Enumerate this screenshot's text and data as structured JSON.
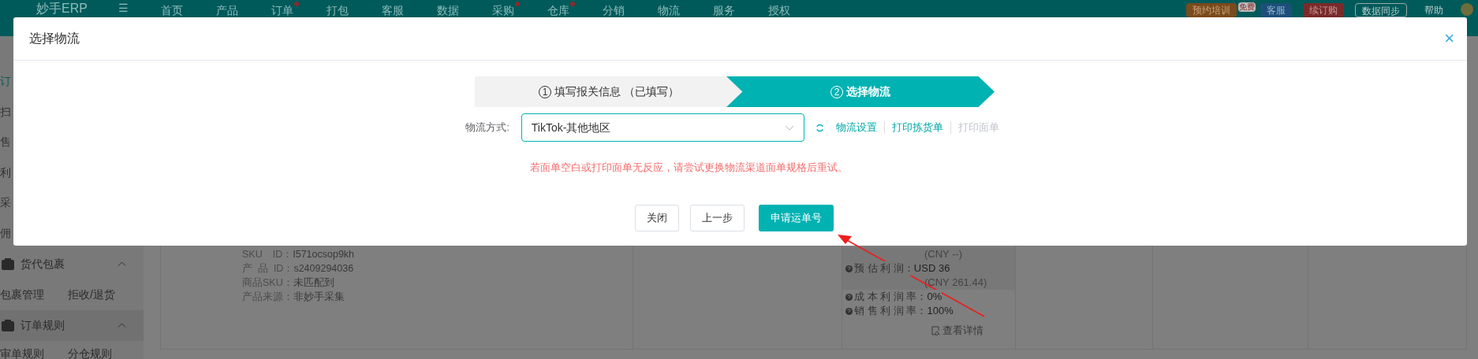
{
  "header": {
    "logo": "妙手ERP",
    "menu_icon": "☰",
    "nav": [
      {
        "label": "首页",
        "dot": false
      },
      {
        "label": "产品",
        "dot": false
      },
      {
        "label": "订单",
        "dot": true
      },
      {
        "label": "打包",
        "dot": false
      },
      {
        "label": "客服",
        "dot": false
      },
      {
        "label": "数据",
        "dot": false
      },
      {
        "label": "采购",
        "dot": true
      },
      {
        "label": "仓库",
        "dot": true
      },
      {
        "label": "分销",
        "dot": false
      },
      {
        "label": "物流",
        "dot": false
      },
      {
        "label": "服务",
        "dot": false
      },
      {
        "label": "授权",
        "dot": false
      }
    ],
    "actions": [
      {
        "label": "预约培训",
        "kind": "orange",
        "badge": "免费"
      },
      {
        "label": "客服",
        "kind": "blue"
      },
      {
        "label": "续订购",
        "kind": "red"
      },
      {
        "label": "数据同步",
        "kind": "outline"
      },
      {
        "label": "帮助",
        "kind": "plain"
      }
    ]
  },
  "sidebar": {
    "fragments": [
      {
        "label": "订",
        "selected": true
      },
      {
        "label": "扫",
        "selected": false
      },
      {
        "label": "售",
        "selected": false
      },
      {
        "label": "利",
        "selected": false
      },
      {
        "label": "采",
        "selected": false
      },
      {
        "label": "佣",
        "selected": false
      }
    ],
    "groups": [
      {
        "title": "货代包裹",
        "expanded": true,
        "items": [
          "包裹管理",
          "拒收/退货"
        ]
      },
      {
        "title": "订单规则",
        "expanded": true,
        "items": [
          "审单规则",
          "分仓规则"
        ]
      }
    ]
  },
  "order": {
    "sku_lines": [
      {
        "label": "SKU　ID：",
        "value": "I571ocsop9kh"
      },
      {
        "label": "产  品  ID：",
        "value": "s2409294036"
      },
      {
        "label": "商品SKU：",
        "value": "未匹配到"
      },
      {
        "label": "产品来源：",
        "value": "非妙手采集"
      }
    ],
    "profit_lines": [
      {
        "kind": "note",
        "value": "(CNY --)"
      },
      {
        "kind": "item",
        "label": "预 估 利 润：",
        "value": "USD 36"
      },
      {
        "kind": "note",
        "value": "(CNY 261.44)"
      },
      {
        "kind": "item",
        "label": "成 本 利 润 率：",
        "value": "0%"
      },
      {
        "kind": "item",
        "label": "销 售 利 润 率：",
        "value": "100%"
      }
    ],
    "details_link": "查看详情"
  },
  "dialog": {
    "title": "选择物流",
    "close": "×",
    "steps": [
      {
        "number": "1",
        "label": "填写报关信息 （已填写）",
        "selected": false
      },
      {
        "number": "2",
        "label": "选择物流",
        "selected": true
      }
    ],
    "field_label": "物流方式:",
    "select_value": "TikTok-其他地区",
    "links": [
      {
        "label": "物流设置",
        "disabled": false
      },
      {
        "label": "打印拣货单",
        "disabled": false
      },
      {
        "label": "打印面单",
        "disabled": true
      }
    ],
    "warning": "若面单空白或打印面单无反应，请尝试更换物流渠道面单规格后重试。",
    "buttons": [
      {
        "label": "关闭",
        "kind": "default"
      },
      {
        "label": "上一步",
        "kind": "default"
      },
      {
        "label": "申请运单号",
        "kind": "primary"
      }
    ]
  }
}
